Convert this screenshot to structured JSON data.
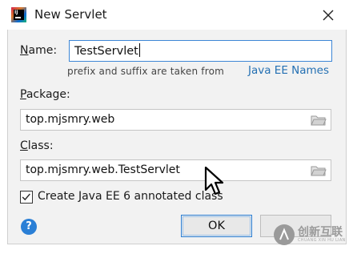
{
  "window": {
    "title": "New Servlet"
  },
  "form": {
    "name_label_u": "N",
    "name_label_rest": "ame:",
    "name_value": "TestServlet",
    "hint": "prefix and suffix are taken from",
    "link": "Java EE Names",
    "package_label_u": "P",
    "package_label_rest": "ackage:",
    "package_value": "top.mjsmry.web",
    "class_label_u": "C",
    "class_label_rest": "lass:",
    "class_value": "top.mjsmry.web.TestServlet",
    "annotated_checked": true,
    "annotated_label": "Create Java EE 6 annotated class"
  },
  "buttons": {
    "help": "?",
    "ok": "OK",
    "cancel": ""
  },
  "watermark": {
    "text": "创新互联",
    "sub": "CHUANG XIN HU LIAN"
  },
  "colors": {
    "accent": "#2a7fd6",
    "link": "#2470b3",
    "dialog_bg": "#f2f2f2"
  },
  "icons": [
    "intellij-app-icon",
    "close-icon",
    "folder-icon",
    "checkmark-icon",
    "help-icon",
    "mouse-cursor-icon"
  ]
}
